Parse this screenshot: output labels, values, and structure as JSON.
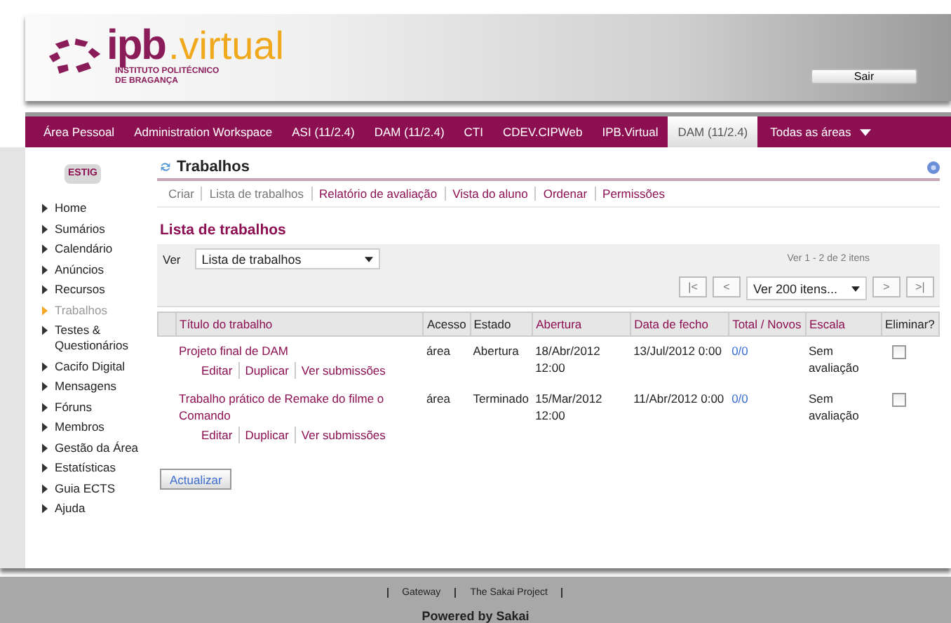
{
  "header": {
    "logo_main": "ipb",
    "logo_suffix": ".virtual",
    "logo_line1": "INSTITUTO POLITÉCNICO",
    "logo_line2": "DE BRAGANÇA",
    "logout": "Sair"
  },
  "nav": [
    {
      "label": "Área Pessoal",
      "selected": false
    },
    {
      "label": "Administration Workspace",
      "selected": false
    },
    {
      "label": "ASI (11/2.4)",
      "selected": false
    },
    {
      "label": "DAM (11/2.4)",
      "selected": false
    },
    {
      "label": "CTI",
      "selected": false
    },
    {
      "label": "CDEV.CIPWeb",
      "selected": false
    },
    {
      "label": "IPB.Virtual",
      "selected": false
    },
    {
      "label": "DAM (11/2.4)",
      "selected": true
    }
  ],
  "nav_more": "Todas as áreas",
  "sidebar": {
    "logo": "ESTIG",
    "items": [
      {
        "label": "Home",
        "selected": false
      },
      {
        "label": "Sumários",
        "selected": false
      },
      {
        "label": "Calendário",
        "selected": false
      },
      {
        "label": "Anúncios",
        "selected": false
      },
      {
        "label": "Recursos",
        "selected": false
      },
      {
        "label": "Trabalhos",
        "selected": true
      },
      {
        "label": "Testes & Questionários",
        "selected": false
      },
      {
        "label": "Cacifo Digital",
        "selected": false
      },
      {
        "label": "Mensagens",
        "selected": false
      },
      {
        "label": "Fóruns",
        "selected": false
      },
      {
        "label": "Membros",
        "selected": false
      },
      {
        "label": "Gestão da Área",
        "selected": false
      },
      {
        "label": "Estatísticas",
        "selected": false
      },
      {
        "label": "Guia ECTS",
        "selected": false
      },
      {
        "label": "Ajuda",
        "selected": false
      }
    ]
  },
  "tool": {
    "title": "Trabalhos",
    "menu": [
      {
        "label": "Criar",
        "link": false
      },
      {
        "label": "Lista de trabalhos",
        "link": false
      },
      {
        "label": "Relatório de avaliação",
        "link": true
      },
      {
        "label": "Vista do aluno",
        "link": true
      },
      {
        "label": "Ordenar",
        "link": true
      },
      {
        "label": "Permissões",
        "link": true
      }
    ]
  },
  "list": {
    "heading": "Lista de trabalhos",
    "view_label": "Ver",
    "view_value": "Lista de trabalhos",
    "pager_info": "Ver 1 - 2 de 2 itens",
    "pager_first": "|<",
    "pager_prev": "<",
    "page_size": "Ver 200 itens...",
    "pager_next": ">",
    "pager_last": ">|"
  },
  "table": {
    "columns": [
      "Título do trabalho",
      "Acesso",
      "Estado",
      "Abertura",
      "Data de fecho",
      "Total / Novos",
      "Escala",
      "Eliminar?"
    ],
    "rows": [
      {
        "title": "Projeto final de DAM",
        "access": "área",
        "status": "Abertura",
        "open": "18/Abr/2012 12:00",
        "close": "13/Jul/2012 0:00",
        "total": "0/0",
        "scale": "Sem avaliação",
        "checked": false,
        "actions": [
          "Editar",
          "Duplicar",
          "Ver submissões"
        ]
      },
      {
        "title": "Trabalho prático de Remake do filme o Comando",
        "access": "área",
        "status": "Terminado",
        "open": "15/Mar/2012 12:00",
        "close": "11/Abr/2012 0:00",
        "total": "0/0",
        "scale": "Sem avaliação",
        "checked": false,
        "actions": [
          "Editar",
          "Duplicar",
          "Ver submissões"
        ]
      }
    ]
  },
  "update_button": "Actualizar",
  "footer": {
    "links": [
      "Gateway",
      "The Sakai Project"
    ],
    "powered": "Powered by Sakai"
  }
}
